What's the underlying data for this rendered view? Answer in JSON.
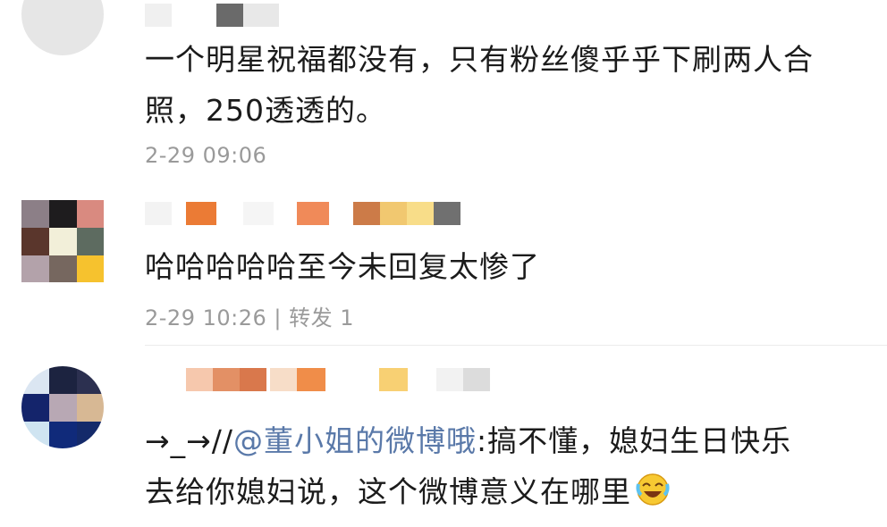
{
  "comments": [
    {
      "text_line1": "一个明星祝福都没有，只有粉丝傻乎乎下刷两人合",
      "text_line2": "照，250透透的。",
      "time": "2-29 09:06"
    },
    {
      "text_line1": "哈哈哈哈哈至今未回复太惨了",
      "time": "2-29 10:26",
      "separator": "|",
      "repost_label": "转发 1"
    },
    {
      "prefix": "→_→//",
      "mention": "@董小姐的微博哦",
      "rest_line1": ":搞不懂，媳妇生日快乐",
      "text_line2": "去给你媳妇说，这个微博意义在哪里",
      "emoji": "laugh-cry-emoji"
    }
  ],
  "colors": {
    "text": "#1b1b1b",
    "meta": "#9a9a9a",
    "mention": "#5a79a9",
    "divider": "#ebebeb"
  }
}
